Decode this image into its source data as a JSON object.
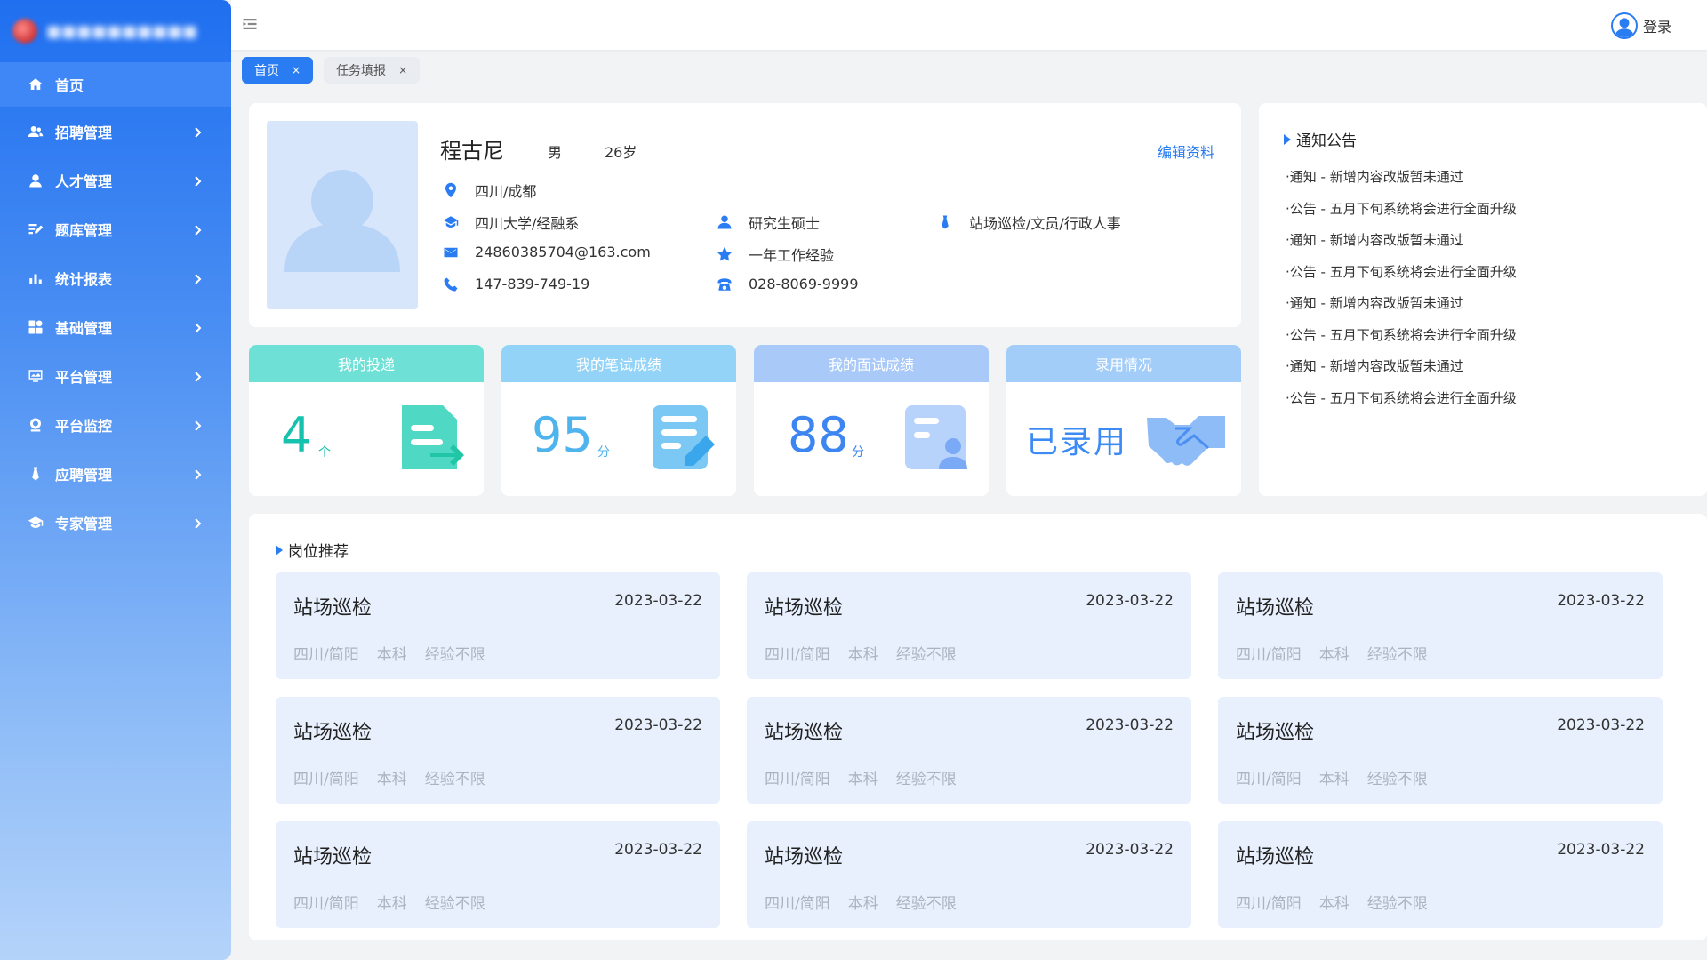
{
  "sidebar": {
    "items": [
      {
        "label": "首页",
        "icon": "home-icon"
      },
      {
        "label": "招聘管理",
        "icon": "users-icon"
      },
      {
        "label": "人才管理",
        "icon": "user-icon"
      },
      {
        "label": "题库管理",
        "icon": "edit-list-icon"
      },
      {
        "label": "统计报表",
        "icon": "bar-chart-icon"
      },
      {
        "label": "基础管理",
        "icon": "grid-icon"
      },
      {
        "label": "平台管理",
        "icon": "monitor-icon"
      },
      {
        "label": "平台监控",
        "icon": "camera-icon"
      },
      {
        "label": "应聘管理",
        "icon": "tie-icon"
      },
      {
        "label": "专家管理",
        "icon": "graduation-cap-icon"
      }
    ]
  },
  "header": {
    "login_label": "登录"
  },
  "tabs": [
    {
      "label": "首页",
      "close": "×"
    },
    {
      "label": "任务填报",
      "close": "×"
    }
  ],
  "profile": {
    "name": "程古尼",
    "gender": "男",
    "age": "26岁",
    "edit_label": "编辑资料",
    "location": "四川/成都",
    "school": "四川大学/经融系",
    "email": "24860385704@163.com",
    "phone": "147-839-749-19",
    "degree": "研究生硕士",
    "experience": "一年工作经验",
    "tel": "028-8069-9999",
    "positions": "站场巡检/文员/行政人事"
  },
  "stats": [
    {
      "title": "我的投递",
      "value": "4",
      "unit": "个",
      "head_color": "#6fe0d6",
      "value_color": "#16c2ad"
    },
    {
      "title": "我的笔试成绩",
      "value": "95",
      "unit": "分",
      "head_color": "#92d3f7",
      "value_color": "#4fb3ee"
    },
    {
      "title": "我的面试成绩",
      "value": "88",
      "unit": "分",
      "head_color": "#a9c9f9",
      "value_color": "#3d86f2"
    },
    {
      "title": "录用情况",
      "text": "已录用",
      "head_color": "#a3cdf9"
    }
  ],
  "notice": {
    "title": "通知公告",
    "items": [
      "·通知 - 新增内容改版暂未通过",
      "·公告 - 五月下旬系统将会进行全面升级",
      "·通知 - 新增内容改版暂未通过",
      "·公告 - 五月下旬系统将会进行全面升级",
      "·通知 - 新增内容改版暂未通过",
      "·公告 - 五月下旬系统将会进行全面升级",
      "·通知 - 新增内容改版暂未通过",
      "·公告 - 五月下旬系统将会进行全面升级"
    ]
  },
  "jobs": {
    "title": "岗位推荐",
    "items": [
      {
        "title": "站场巡检",
        "date": "2023-03-22",
        "location": "四川/简阳",
        "education": "本科",
        "experience": "经验不限"
      },
      {
        "title": "站场巡检",
        "date": "2023-03-22",
        "location": "四川/简阳",
        "education": "本科",
        "experience": "经验不限"
      },
      {
        "title": "站场巡检",
        "date": "2023-03-22",
        "location": "四川/简阳",
        "education": "本科",
        "experience": "经验不限"
      },
      {
        "title": "站场巡检",
        "date": "2023-03-22",
        "location": "四川/简阳",
        "education": "本科",
        "experience": "经验不限"
      },
      {
        "title": "站场巡检",
        "date": "2023-03-22",
        "location": "四川/简阳",
        "education": "本科",
        "experience": "经验不限"
      },
      {
        "title": "站场巡检",
        "date": "2023-03-22",
        "location": "四川/简阳",
        "education": "本科",
        "experience": "经验不限"
      },
      {
        "title": "站场巡检",
        "date": "2023-03-22",
        "location": "四川/简阳",
        "education": "本科",
        "experience": "经验不限"
      },
      {
        "title": "站场巡检",
        "date": "2023-03-22",
        "location": "四川/简阳",
        "education": "本科",
        "experience": "经验不限"
      },
      {
        "title": "站场巡检",
        "date": "2023-03-22",
        "location": "四川/简阳",
        "education": "本科",
        "experience": "经验不限"
      }
    ]
  }
}
